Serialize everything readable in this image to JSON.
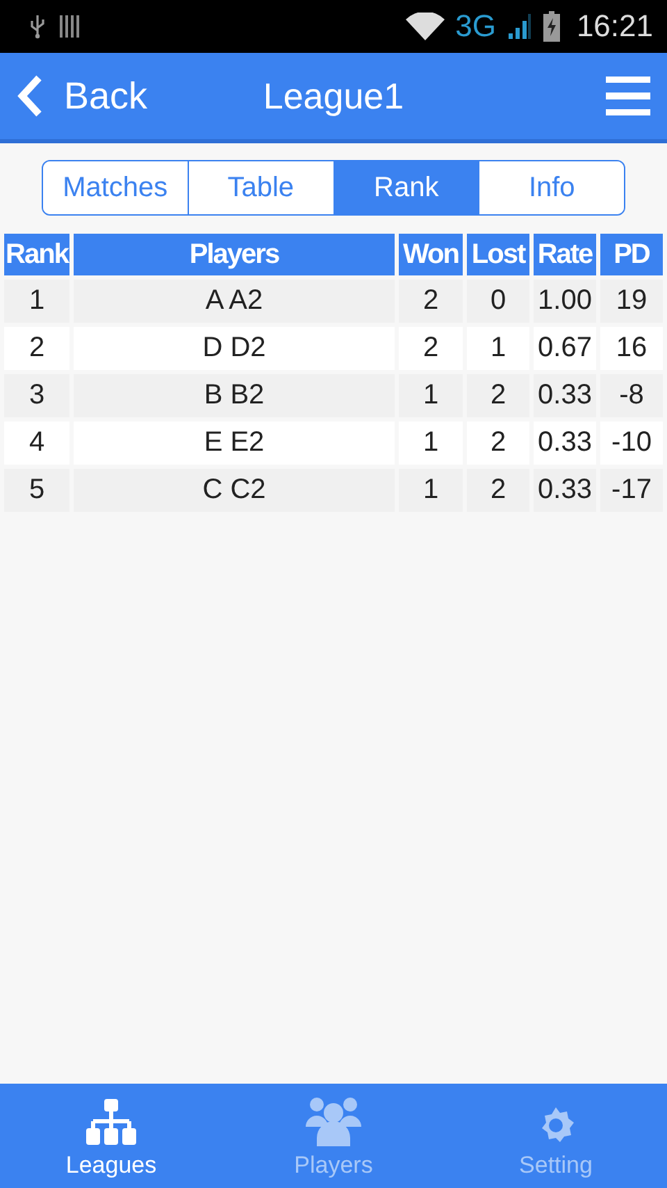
{
  "status_bar": {
    "network": "3G",
    "time": "16:21"
  },
  "header": {
    "back": "Back",
    "title": "League1"
  },
  "tabs": [
    {
      "label": "Matches",
      "selected": false
    },
    {
      "label": "Table",
      "selected": false
    },
    {
      "label": "Rank",
      "selected": true
    },
    {
      "label": "Info",
      "selected": false
    }
  ],
  "table": {
    "columns": [
      "Rank",
      "Players",
      "Won",
      "Lost",
      "Rate",
      "PD"
    ],
    "rows": [
      [
        "1",
        "A A2",
        "2",
        "0",
        "1.00",
        "19"
      ],
      [
        "2",
        "D D2",
        "2",
        "1",
        "0.67",
        "16"
      ],
      [
        "3",
        "B B2",
        "1",
        "2",
        "0.33",
        "-8"
      ],
      [
        "4",
        "E E2",
        "1",
        "2",
        "0.33",
        "-10"
      ],
      [
        "5",
        "C C2",
        "1",
        "2",
        "0.33",
        "-17"
      ]
    ]
  },
  "bottom_nav": [
    {
      "kind": "leagues",
      "label": "Leagues",
      "selected": true
    },
    {
      "kind": "players",
      "label": "Players",
      "selected": false
    },
    {
      "kind": "setting",
      "label": "Setting",
      "selected": false
    }
  ]
}
